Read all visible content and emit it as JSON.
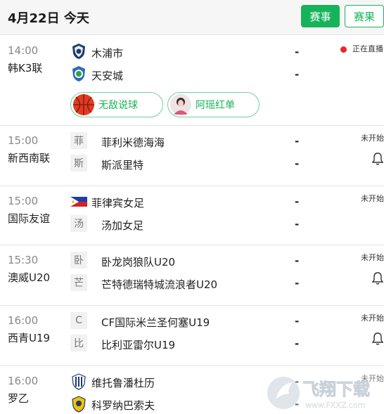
{
  "header": {
    "title": "4月22日 今天",
    "btn_schedule": "赛事",
    "btn_results": "赛果"
  },
  "matches": [
    {
      "time": "14:00",
      "league": "韩K3联",
      "home": "木浦市",
      "away": "天安城",
      "home_score": "-",
      "away_score": "-",
      "status": "正在直播",
      "anchors": [
        {
          "name": "无敌说球"
        },
        {
          "name": "阿瑶红单"
        }
      ]
    },
    {
      "time": "15:00",
      "league": "新西南联",
      "home": "菲利米德海海",
      "home_icon": "菲",
      "away": "斯派里特",
      "away_icon": "斯",
      "home_score": "-",
      "away_score": "-",
      "status": "未开始"
    },
    {
      "time": "15:00",
      "league": "国际友谊",
      "home": "菲律宾女足",
      "away": "汤加女足",
      "away_icon": "汤",
      "home_score": "-",
      "away_score": "-",
      "status": "未开始"
    },
    {
      "time": "15:30",
      "league": "澳威U20",
      "home": "卧龙岗狼队U20",
      "home_icon": "卧",
      "away": "芒特德瑞特城流浪者U20",
      "away_icon": "芒",
      "home_score": "-",
      "away_score": "-",
      "status": "未开始"
    },
    {
      "time": "16:00",
      "league": "西青U19",
      "home": "CF国际米兰圣何塞U19",
      "home_icon": "C",
      "away": "比利亚雷尔U19",
      "away_icon": "比",
      "home_score": "-",
      "away_score": "-",
      "status": "未开始"
    },
    {
      "time": "16:00",
      "league": "罗乙",
      "home": "维托鲁潘杜历",
      "away": "科罗纳巴索夫",
      "home_score": "-",
      "away_score": "-",
      "status": "未开始"
    }
  ],
  "watermark": {
    "brand": "飞翔下载",
    "url": "www.FXXZ.com"
  },
  "colors": {
    "accent": "#17b35a",
    "live": "#e8262d"
  }
}
